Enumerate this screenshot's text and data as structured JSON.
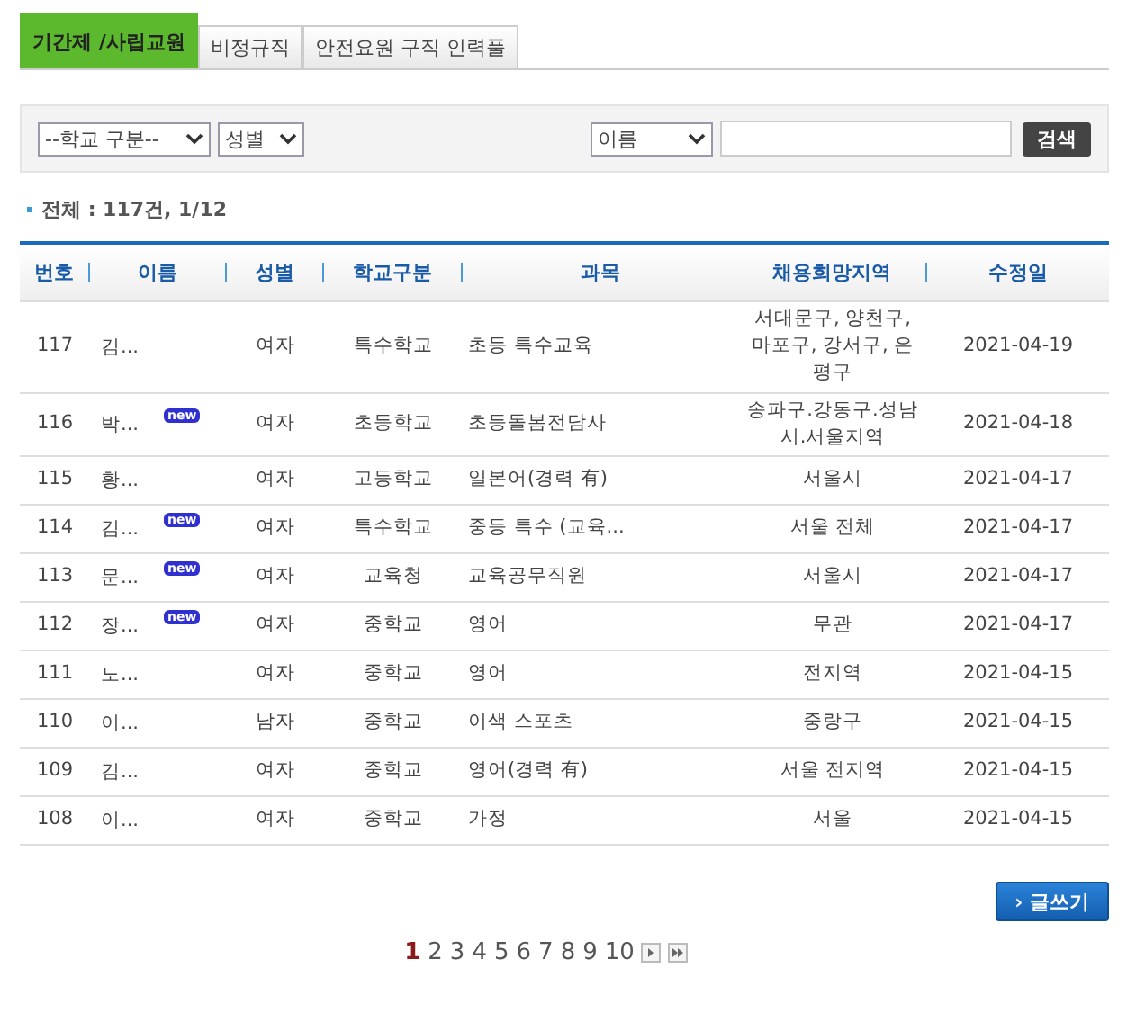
{
  "tabs": [
    {
      "label": "기간제 /사립교원",
      "selected": true
    },
    {
      "label": "비정규직",
      "selected": false
    },
    {
      "label": "안전요원 구직 인력풀",
      "selected": false
    }
  ],
  "filters": {
    "school_type": "--학교 구분--",
    "gender": "성별",
    "search_field": "이름",
    "search_button": "검색"
  },
  "summary": "전체 : 117건, 1/12",
  "columns": [
    "번호",
    "이름",
    "성별",
    "학교구분",
    "과목",
    "채용희망지역",
    "수정일"
  ],
  "rows": [
    {
      "no": "117",
      "name": "김...",
      "gender": "여자",
      "school": "특수학교",
      "subject": "초등 특수교육",
      "region": "서대문구, 양천구, 마포구, 강서구, 은평구",
      "date": "2021-04-19"
    },
    {
      "no": "116",
      "name": "박...",
      "badge": "new",
      "gender": "여자",
      "school": "초등학교",
      "subject": "초등돌봄전담사",
      "region": "송파구.강동구.성남시.서울지역",
      "date": "2021-04-18"
    },
    {
      "no": "115",
      "name": "황...",
      "gender": "여자",
      "school": "고등학교",
      "subject": "일본어(경력 有)",
      "region": "서울시",
      "date": "2021-04-17"
    },
    {
      "no": "114",
      "name": "김...",
      "badge": "new",
      "gender": "여자",
      "school": "특수학교",
      "subject": "중등 특수 (교육...",
      "region": "서울 전체",
      "date": "2021-04-17"
    },
    {
      "no": "113",
      "name": "문...",
      "badge": "new",
      "gender": "여자",
      "school": "교육청",
      "subject": "교육공무직원",
      "region": "서울시",
      "date": "2021-04-17"
    },
    {
      "no": "112",
      "name": "장...",
      "badge": "new",
      "gender": "여자",
      "school": "중학교",
      "subject": "영어",
      "region": "무관",
      "date": "2021-04-17"
    },
    {
      "no": "111",
      "name": "노...",
      "gender": "여자",
      "school": "중학교",
      "subject": "영어",
      "region": "전지역",
      "date": "2021-04-15"
    },
    {
      "no": "110",
      "name": "이...",
      "gender": "남자",
      "school": "중학교",
      "subject": "이색 스포츠",
      "region": "중랑구",
      "date": "2021-04-15"
    },
    {
      "no": "109",
      "name": "김...",
      "gender": "여자",
      "school": "중학교",
      "subject": "영어(경력 有)",
      "region": "서울 전지역",
      "date": "2021-04-15"
    },
    {
      "no": "108",
      "name": "이...",
      "gender": "여자",
      "school": "중학교",
      "subject": "가정",
      "region": "서울",
      "date": "2021-04-15"
    }
  ],
  "write_button": "› 글쓰기",
  "pages": [
    {
      "label": "1",
      "selected": true
    },
    {
      "label": "2",
      "selected": false
    },
    {
      "label": "3",
      "selected": false
    },
    {
      "label": "4",
      "selected": false
    },
    {
      "label": "5",
      "selected": false
    },
    {
      "label": "6",
      "selected": false
    },
    {
      "label": "7",
      "selected": false
    },
    {
      "label": "8",
      "selected": false
    },
    {
      "label": "9",
      "selected": false
    },
    {
      "label": "10",
      "selected": false
    }
  ]
}
